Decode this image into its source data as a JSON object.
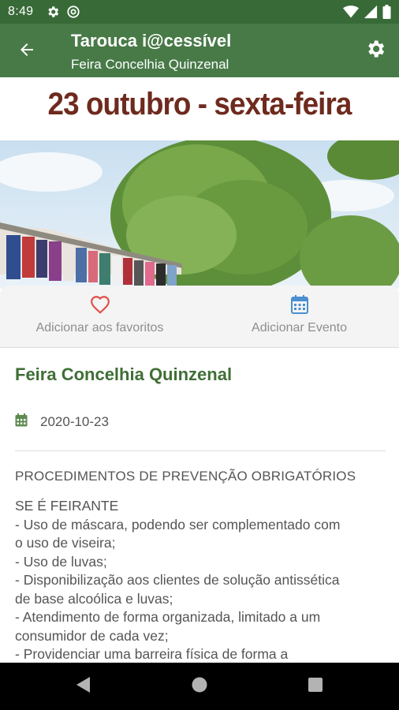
{
  "status_bar": {
    "time": "8:49",
    "icons_left": [
      "gear-icon",
      "at-sign-icon"
    ],
    "icons_right": [
      "wifi-icon",
      "signal-icon",
      "battery-icon"
    ]
  },
  "app_bar": {
    "title": "Tarouca i@cessível",
    "subtitle": "Feira Concelhia Quinzenal",
    "back_icon": "arrow-back-icon",
    "settings_icon": "gear-icon",
    "color": "#487a48"
  },
  "hero": {
    "banner_text": "23 outubro - sexta-feira",
    "banner_color": "#6e2a1e"
  },
  "actions": [
    {
      "label": "Adicionar aos favoritos",
      "icon": "heart-icon",
      "icon_color": "#e0504a"
    },
    {
      "label": "Adicionar Evento",
      "icon": "calendar-icon",
      "icon_color": "#4a8fd0"
    }
  ],
  "event": {
    "title": "Feira Concelhia Quinzenal",
    "date": "2020-10-23",
    "section_heading": "PROCEDIMENTOS DE PREVENÇÃO OBRIGATÓRIOS",
    "body_lines": [
      "SE É FEIRANTE",
      "- Uso de máscara, podendo ser complementado com",
      "o uso de viseira;",
      "- Uso de luvas;",
      "- Disponibilização aos clientes de solução antissética",
      "de base alcoólica e luvas;",
      "- Atendimento de forma organizada, limitado a um",
      "consumidor de cada vez;",
      "- Providenciar uma barreira física de forma a"
    ],
    "title_color": "#3f6e35"
  },
  "nav_bar": {
    "buttons": [
      "back-triangle-icon",
      "home-circle-icon",
      "recents-square-icon"
    ]
  }
}
